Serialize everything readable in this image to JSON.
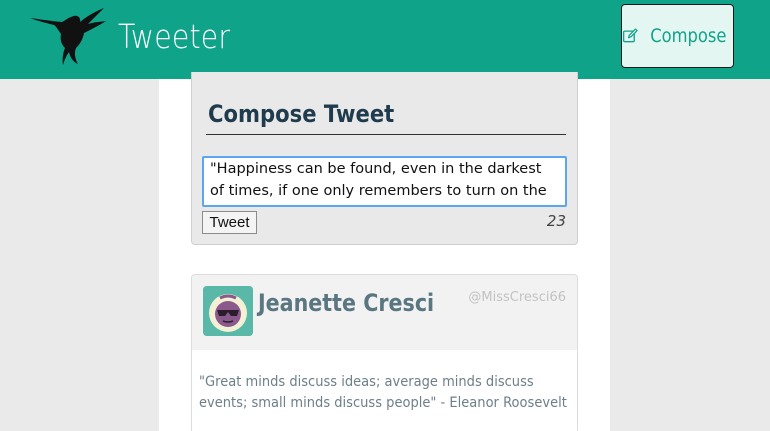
{
  "navbar": {
    "brand": "Tweeter",
    "compose_label": "Compose",
    "accent_color": "#0fa38a",
    "logo_icon": "hummingbird-icon",
    "compose_icon": "edit-icon"
  },
  "compose": {
    "title": "Compose Tweet",
    "input_value": "\"Happiness can be found, even in the darkest of times, if one only remembers to turn on the light\" - Albus Dumbledore",
    "submit_label": "Tweet",
    "char_counter": "23"
  },
  "tweets": [
    {
      "name": "Jeanette Cresci",
      "handle": "@MissCresci66",
      "avatar_icon": "sunglasses-avatar-icon",
      "text": "\"Great minds discuss ideas; average minds discuss events; small minds discuss people\" - Eleanor Roosevelt"
    }
  ]
}
